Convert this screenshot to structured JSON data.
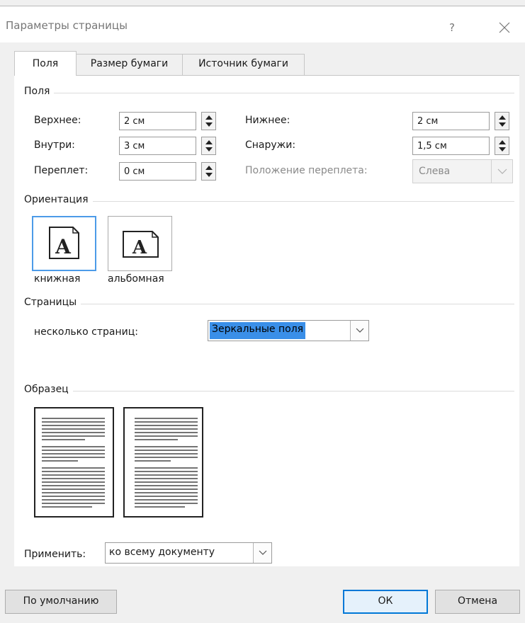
{
  "window": {
    "title": "Параметры страницы",
    "help_label": "?",
    "close_icon": "close-icon"
  },
  "tabs": [
    {
      "label": "Поля",
      "active": true
    },
    {
      "label": "Размер бумаги",
      "active": false
    },
    {
      "label": "Источник бумаги",
      "active": false
    }
  ],
  "margins": {
    "group_label": "Поля",
    "top": {
      "label": "Верхнее:",
      "value": "2 см"
    },
    "bottom": {
      "label": "Нижнее:",
      "value": "2 см"
    },
    "inside": {
      "label": "Внутри:",
      "value": "3 см"
    },
    "outside": {
      "label": "Снаружи:",
      "value": "1,5 см"
    },
    "gutter": {
      "label": "Переплет:",
      "value": "0 см"
    },
    "gutter_position": {
      "label": "Положение переплета:",
      "value": "Слева"
    }
  },
  "orientation": {
    "group_label": "Ориентация",
    "portrait_label": "книжная",
    "landscape_label": "альбомная",
    "icon_glyph": "A",
    "selected": "portrait"
  },
  "pages": {
    "group_label": "Страницы",
    "multiple_label": "несколько страниц:",
    "multiple_value": "Зеркальные поля"
  },
  "preview": {
    "group_label": "Образец"
  },
  "apply": {
    "label": "Применить:",
    "value": "ко всему документу"
  },
  "buttons": {
    "default_label": "По умолчанию",
    "ok_label": "ОК",
    "cancel_label": "Отмена"
  },
  "colors": {
    "accent": "#0078d7",
    "selection": "#3a8fe8",
    "orientation_selected": "#4c9be8"
  }
}
